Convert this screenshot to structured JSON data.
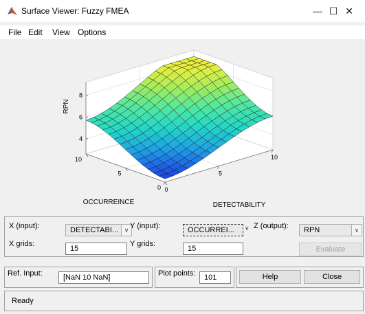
{
  "window": {
    "title": "Surface Viewer: Fuzzy FMEA",
    "minimize_glyph": "—",
    "maximize_glyph": "☐",
    "close_glyph": "✕",
    "icon": "matlab-icon"
  },
  "menu": {
    "items": [
      "File",
      "Edit",
      "View",
      "Options"
    ]
  },
  "plot": {
    "zlabel": "RPN",
    "xlabel": "DETECTABILITY",
    "ylabel": "OCCURREINCE",
    "z_ticks": [
      "4",
      "6",
      "8"
    ],
    "x_ticks": [
      "0",
      "5",
      "10"
    ],
    "y_ticks": [
      "0",
      "5",
      "10"
    ],
    "colormap": [
      "#1e46e6",
      "#1fa0e6",
      "#22d6c8",
      "#52e8a0",
      "#a6ec5c",
      "#eef03a"
    ]
  },
  "controls": {
    "x_input_label": "X (input):",
    "x_input_value": "DETECTABI...",
    "y_input_label": "Y (input):",
    "y_input_value": "OCCURREI...",
    "z_output_label": "Z (output):",
    "z_output_value": "RPN",
    "x_grids_label": "X grids:",
    "x_grids_value": "15",
    "y_grids_label": "Y grids:",
    "y_grids_value": "15",
    "evaluate_label": "Evaluate",
    "ref_input_label": "Ref. Input:",
    "ref_input_value": "[NaN 10 NaN]",
    "plot_points_label": "Plot points:",
    "plot_points_value": "101",
    "help_label": "Help",
    "close_label": "Close"
  },
  "status": {
    "text": "Ready"
  }
}
